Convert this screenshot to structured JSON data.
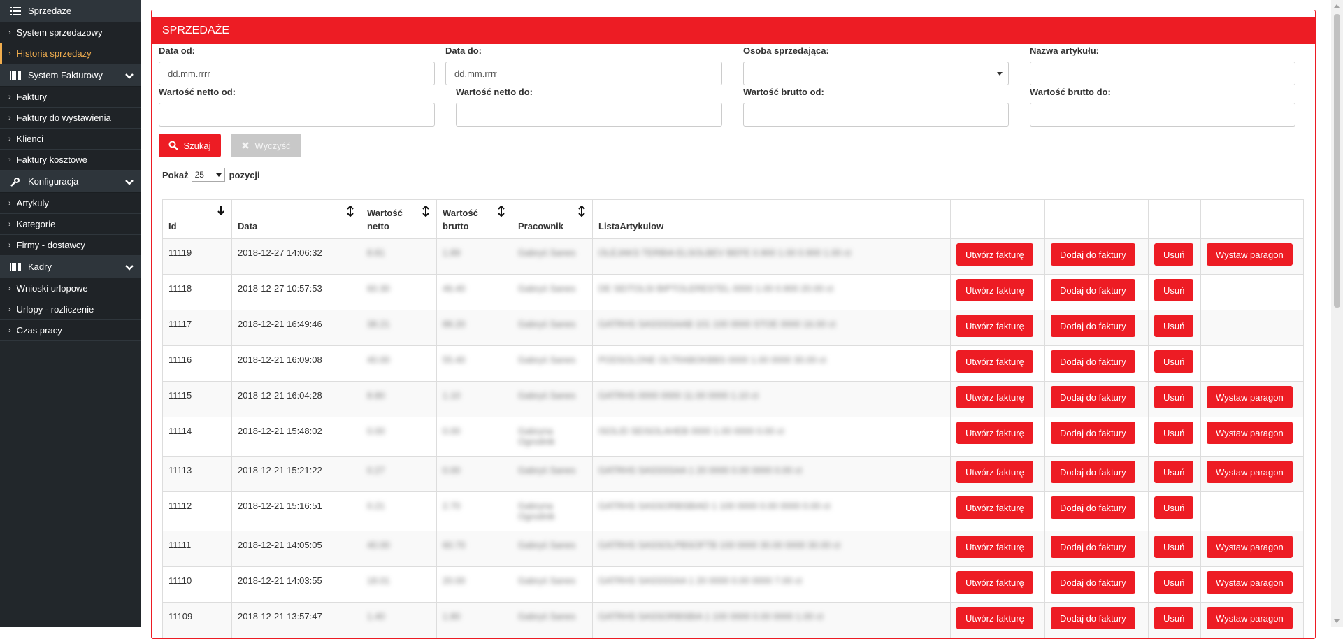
{
  "sidebar": {
    "sections": [
      {
        "title": "Sprzedaze",
        "icon": "list-icon",
        "items": [
          {
            "label": "System sprzedazowy",
            "active": false
          },
          {
            "label": "Historia sprzedazy",
            "active": true
          }
        ]
      },
      {
        "title": "System Fakturowy",
        "icon": "barcode-icon",
        "items": [
          {
            "label": "Faktury"
          },
          {
            "label": "Faktury do wystawienia"
          },
          {
            "label": "Klienci"
          },
          {
            "label": "Faktury kosztowe"
          }
        ]
      },
      {
        "title": "Konfiguracja",
        "icon": "wrench-icon",
        "items": [
          {
            "label": "Artykuly"
          },
          {
            "label": "Kategorie"
          },
          {
            "label": "Firmy - dostawcy"
          }
        ]
      },
      {
        "title": "Kadry",
        "icon": "barcode-icon",
        "items": [
          {
            "label": "Wnioski urlopowe"
          },
          {
            "label": "Urlopy - rozliczenie"
          },
          {
            "label": "Czas pracy"
          }
        ]
      }
    ],
    "arrow_glyph": "›"
  },
  "panel": {
    "title": "SPRZEDAŻE"
  },
  "filters": {
    "date_from_label": "Data od:",
    "date_from_placeholder": "dd.mm.rrrr",
    "date_to_label": "Data do:",
    "date_to_placeholder": "dd.mm.rrrr",
    "seller_label": "Osoba sprzedająca:",
    "article_label": "Nazwa artykułu:",
    "net_from_label": "Wartość netto od:",
    "net_to_label": "Wartość netto do:",
    "gross_from_label": "Wartość brutto od:",
    "gross_to_label": "Wartość brutto do:",
    "search_button": "Szukaj",
    "clear_button": "Wyczyść"
  },
  "page_size": {
    "prefix": "Pokaż",
    "value": "25",
    "suffix": "pozycji"
  },
  "table": {
    "headers": [
      "Id",
      "Data",
      "Wartość netto",
      "Wartość brutto",
      "Pracownik",
      "ListaArtykulow"
    ],
    "button_labels": {
      "invoice": "Utwórz fakturę",
      "add": "Dodaj do faktury",
      "delete": "Usuń",
      "receipt": "Wystaw paragon"
    },
    "rows": [
      {
        "id": "11119",
        "date": "2018-12-27 14:06:32",
        "net": "8.81",
        "gross": "1.89",
        "employee": "Gabryś Sanes",
        "employee2": "",
        "articles": "OLEJAKS TERBIA ELSOLBEV BEFE 0.900 1.00 0.900 1.00 ct",
        "receipt": true
      },
      {
        "id": "11118",
        "date": "2018-12-27 10:57:53",
        "net": "60.30",
        "gross": "46.40",
        "employee": "Gabryś Sanes",
        "employee2": "",
        "articles": "DE SEITOLSI BIPTOLERESTEL 0000 1.00 0.900 20.00 ct",
        "receipt": false
      },
      {
        "id": "11117",
        "date": "2018-12-21 16:49:46",
        "net": "38.21",
        "gross": "88.20",
        "employee": "Gabryś Sanes",
        "employee2": "",
        "articles": "GATRHS SASSSSAAB 101 100 0000 STOE 0000 16.00 ct",
        "receipt": false
      },
      {
        "id": "11116",
        "date": "2018-12-21 16:09:08",
        "net": "40.00",
        "gross": "55.40",
        "employee": "Gabryś Sanes",
        "employee2": "",
        "articles": "PODSOLONE OLTRABOKBBS 0000 1.00 0000 30.00 ct",
        "receipt": false
      },
      {
        "id": "11115",
        "date": "2018-12-21 16:04:28",
        "net": "8.80",
        "gross": "1.10",
        "employee": "Gabryś Sanes",
        "employee2": "",
        "articles": "GATRHS 0000 0000 11.00 0000 1.10 ct",
        "receipt": true
      },
      {
        "id": "11114",
        "date": "2018-12-21 15:48:02",
        "net": "0.00",
        "gross": "0.00",
        "employee": "Gabryna",
        "employee2": "Ogrodnik",
        "articles": "ISOLID SEISOLAHEB 0000 1.00 0000 0.00 ct",
        "receipt": true
      },
      {
        "id": "11113",
        "date": "2018-12-21 15:21:22",
        "net": "0.27",
        "gross": "0.00",
        "employee": "Gabryś Sanes",
        "employee2": "",
        "articles": "GATRHS SASSSSAA 1 20 0000 0.00 0000 0.00 ct",
        "receipt": true
      },
      {
        "id": "11112",
        "date": "2018-12-21 15:16:51",
        "net": "0.21",
        "gross": "2.70",
        "employee": "Gabryna",
        "employee2": "Ogrodnik",
        "articles": "GATRHS SASSORBSBIAD 1 100 0000 0.00 0000 0.00 ct",
        "receipt": false
      },
      {
        "id": "11111",
        "date": "2018-12-21 14:05:05",
        "net": "40.00",
        "gross": "60.70",
        "employee": "Gabryś Sanes",
        "employee2": "",
        "articles": "GATRHS SASSOLPBSOFTB 100 0000 30.00 0000 30.00 ct",
        "receipt": true
      },
      {
        "id": "11110",
        "date": "2018-12-21 14:03:55",
        "net": "18.01",
        "gross": "20.00",
        "employee": "Gabryś Sanes",
        "employee2": "",
        "articles": "GATRHS SASSSSAA 1 20 0000 0.00 0000 7.00 ct",
        "receipt": true
      },
      {
        "id": "11109",
        "date": "2018-12-21 13:57:47",
        "net": "1.40",
        "gross": "1.80",
        "employee": "Gabryś Sanes",
        "employee2": "",
        "articles": "GATRHS SASSORBSBIA 1 100 0000 0.00 0000 1.00 ct",
        "receipt": true
      }
    ]
  },
  "colors": {
    "accent": "#ed1c24",
    "sidebar_bg": "#22272b",
    "active_item": "#f0ad4e",
    "disabled_button": "#c8c8c8"
  }
}
